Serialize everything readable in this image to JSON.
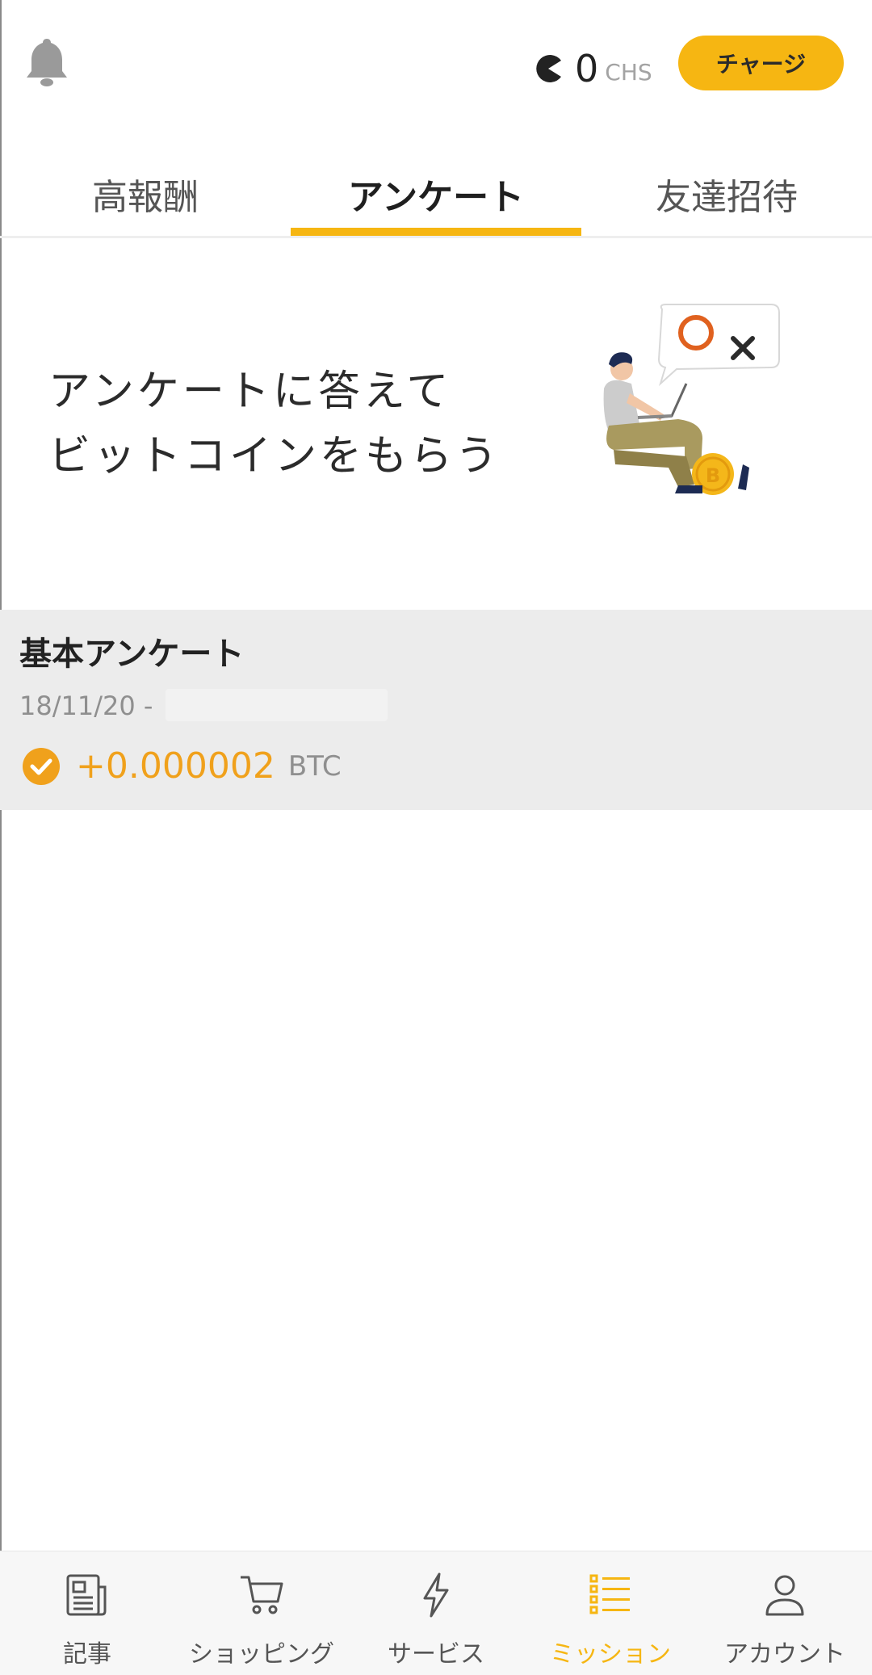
{
  "header": {
    "balance_value": "0",
    "balance_unit": "CHS",
    "charge_label": "チャージ"
  },
  "tabs": [
    {
      "label": "高報酬",
      "active": false
    },
    {
      "label": "アンケート",
      "active": true
    },
    {
      "label": "友達招待",
      "active": false
    }
  ],
  "banner": {
    "line1": "アンケートに答えて",
    "line2": "ビットコインをもらう"
  },
  "survey": {
    "title": "基本アンケート",
    "date": "18/11/20 -",
    "reward_value": "+0.000002",
    "reward_unit": "BTC"
  },
  "bottom_nav": [
    {
      "label": "記事",
      "icon": "newspaper-icon"
    },
    {
      "label": "ショッピング",
      "icon": "cart-icon"
    },
    {
      "label": "サービス",
      "icon": "lightning-icon"
    },
    {
      "label": "ミッション",
      "icon": "list-icon",
      "active": true
    },
    {
      "label": "アカウント",
      "icon": "user-icon"
    }
  ],
  "colors": {
    "accent": "#f6b612",
    "reward": "#f0a11c",
    "card_bg": "#ececec"
  }
}
